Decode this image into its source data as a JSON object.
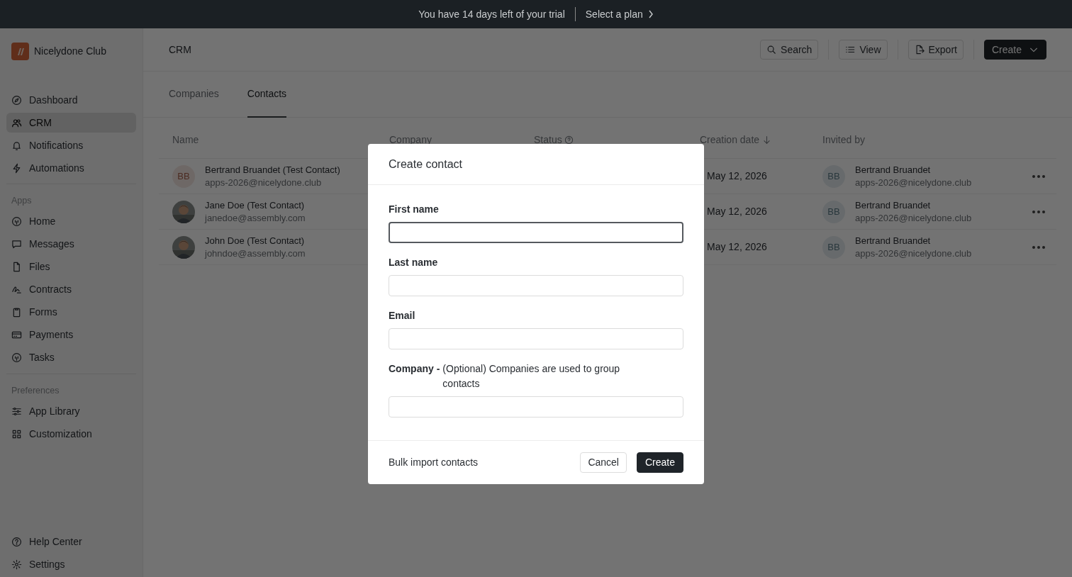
{
  "banner": {
    "message": "You have 14 days left of your trial",
    "link": "Select a plan"
  },
  "sidebar": {
    "brand": "Nicelydone Club",
    "groups": [
      {
        "items": [
          {
            "label": "Dashboard",
            "selected": false
          },
          {
            "label": "CRM",
            "selected": true
          },
          {
            "label": "Notifications",
            "selected": false
          },
          {
            "label": "Automations",
            "selected": false
          }
        ]
      },
      {
        "heading": "Apps",
        "items": [
          {
            "label": "Home",
            "selected": false
          },
          {
            "label": "Messages",
            "selected": false
          },
          {
            "label": "Files",
            "selected": false
          },
          {
            "label": "Contracts",
            "selected": false
          },
          {
            "label": "Forms",
            "selected": false
          },
          {
            "label": "Payments",
            "selected": false
          },
          {
            "label": "Tasks",
            "selected": false
          }
        ]
      },
      {
        "heading": "Preferences",
        "items": [
          {
            "label": "App Library",
            "selected": false
          },
          {
            "label": "Customization",
            "selected": false
          }
        ]
      }
    ],
    "footer": [
      {
        "label": "Help Center",
        "selected": false
      },
      {
        "label": "Settings",
        "selected": false
      }
    ]
  },
  "header": {
    "title": "CRM",
    "buttons": [
      {
        "label": "Search",
        "kind": "search"
      },
      {
        "label": "View",
        "kind": "view"
      },
      {
        "label": "Export",
        "kind": "export"
      },
      {
        "label": "Create",
        "kind": "primary"
      }
    ]
  },
  "tabs": [
    {
      "label": "Companies",
      "selected": false
    },
    {
      "label": "Contacts",
      "selected": true
    }
  ],
  "table": {
    "columns": [
      {
        "label": "Name",
        "sorted": false
      },
      {
        "label": "Company",
        "sorted": false
      },
      {
        "label": "Status",
        "sorted": false
      },
      {
        "label": "Creation date",
        "sorted": true
      },
      {
        "label": "Invited by",
        "sorted": false
      }
    ],
    "rows": [
      {
        "avatar": {
          "kind": "initials",
          "initials": "BB"
        },
        "name": "Bertrand Bruandet (Test Contact)",
        "email": "apps-2026@nicelydone.club",
        "date": "May 12, 2026",
        "inviter": {
          "initials": "BB",
          "name": "Bertrand Bruandet",
          "email": "apps-2026@nicelydone.club"
        }
      },
      {
        "name": "Jane Doe (Test Contact)",
        "email": "janedoe@assembly.com",
        "date": "May 12, 2026",
        "inviter": {
          "initials": "BB",
          "name": "Bertrand Bruandet",
          "email": "apps-2026@nicelydone.club"
        }
      },
      {
        "name": "John Doe (Test Contact)",
        "email": "johndoe@assembly.com",
        "date": "May 12, 2026",
        "inviter": {
          "initials": "BB",
          "name": "Bertrand Bruandet",
          "email": "apps-2026@nicelydone.club"
        }
      }
    ]
  },
  "modal": {
    "title": "Create contact",
    "fields": [
      {
        "label": "First name",
        "focused": true
      },
      {
        "label": "Last name",
        "focused": false
      },
      {
        "label": "Email",
        "focused": false
      },
      {
        "label": "Company -",
        "hint": "(Optional) Companies are used to group contacts",
        "focused": false
      }
    ],
    "footer_link": "Bulk import contacts",
    "buttons": [
      {
        "label": "Cancel",
        "kind": "secondary"
      },
      {
        "label": "Create",
        "kind": "primary"
      }
    ]
  }
}
